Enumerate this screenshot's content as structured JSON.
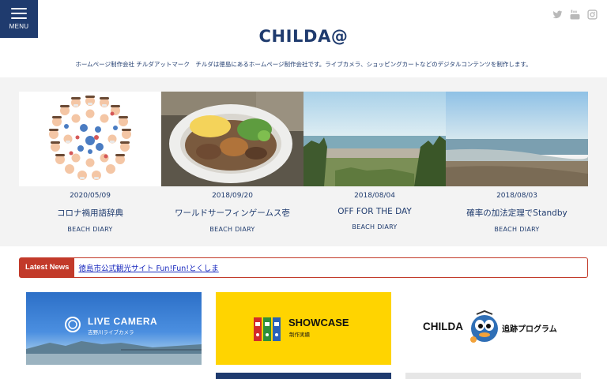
{
  "header": {
    "menu_label": "MENU",
    "logo": "CHILDA@",
    "tagline": "ホームページ制作会社 チルダアットマーク　チルダは徳島にあるホームページ制作会社です。ライブカメラ、ショッピングカートなどのデジタルコンテンツを制作します。",
    "social": [
      "twitter-icon",
      "youtube-icon",
      "instagram-icon"
    ]
  },
  "posts": [
    {
      "date": "2020/05/09",
      "title": "コロナ禍用語辞典",
      "category": "BEACH DIARY"
    },
    {
      "date": "2018/09/20",
      "title": "ワールドサーフィンゲームス壱",
      "category": "BEACH DIARY"
    },
    {
      "date": "2018/08/04",
      "title": "OFF FOR THE DAY",
      "category": "BEACH DIARY"
    },
    {
      "date": "2018/08/03",
      "title": "確率の加法定理でStandby",
      "category": "BEACH DIARY"
    }
  ],
  "news": {
    "label": "Latest News",
    "link_text": "徳島市公式観光サイト Fun!Fun!とくしま"
  },
  "banners": {
    "live_camera": {
      "title": "LIVE CAMERA",
      "subtitle": "吉野川ライブカメラ"
    },
    "showcase": {
      "title": "SHOWCASE",
      "subtitle": "制作実績"
    },
    "childa": {
      "word": "CHILDA",
      "subtitle": "追跡プログラム"
    }
  },
  "colors": {
    "brand_navy": "#1f3b6e",
    "news_red": "#c23a2a",
    "showcase_yellow": "#ffd400",
    "band_gray": "#f3f3f3"
  }
}
